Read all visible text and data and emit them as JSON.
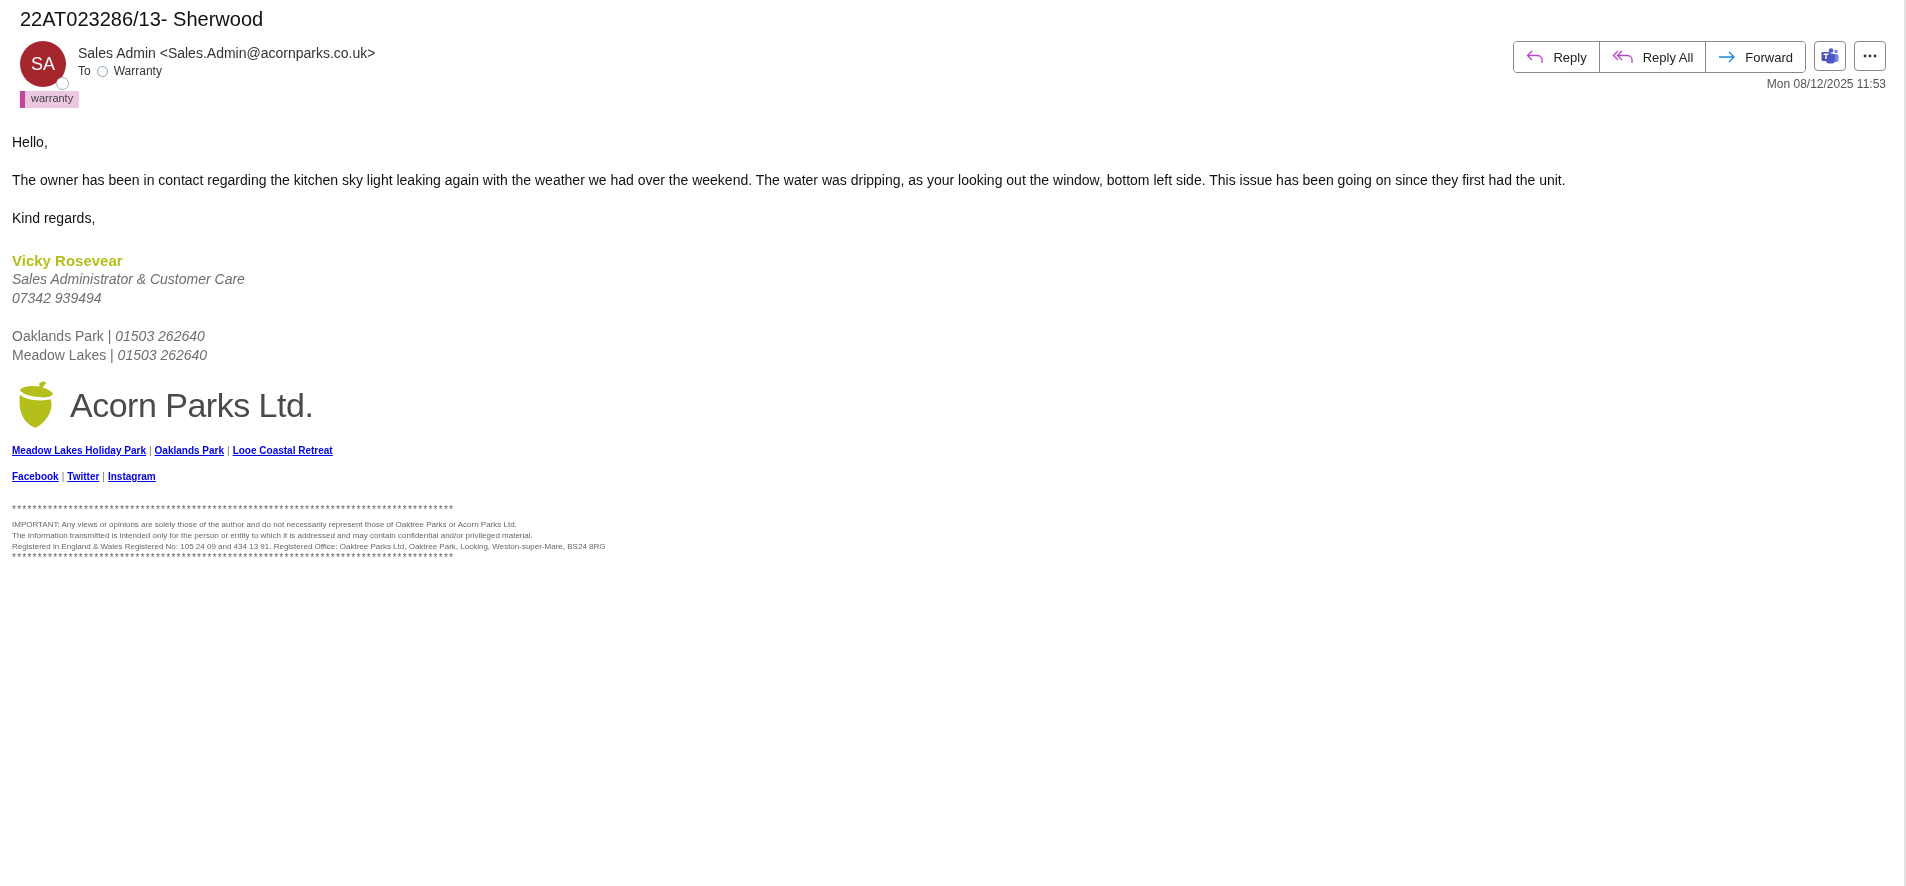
{
  "subject": "22AT023286/13- Sherwood",
  "sender": {
    "initials": "SA",
    "name": "Sales Admin <Sales.Admin@acornparks.co.uk>",
    "to_label": "To",
    "recipient": "Warranty"
  },
  "category": {
    "label": "warranty",
    "color": "#c0479b"
  },
  "actions": [
    {
      "kind": "reply",
      "label": "Reply"
    },
    {
      "kind": "reply_all",
      "label": "Reply All"
    },
    {
      "kind": "forward",
      "label": "Forward"
    }
  ],
  "tools": [
    {
      "kind": "teams"
    },
    {
      "kind": "more"
    }
  ],
  "date": "Mon 08/12/2025 11:53",
  "body": {
    "greeting": "Hello,",
    "paragraph": "The owner has been in contact regarding the kitchen sky light leaking again with the weather we had over the weekend. The water was dripping, as your looking out the window, bottom left side. This issue has been going on since they first had the unit.",
    "closing": "Kind regards,"
  },
  "signature": {
    "name": "Vicky Rosevear",
    "title": "Sales Administrator & Customer Care",
    "phone": "07342 939494",
    "sites": [
      {
        "name": "Oaklands Park |",
        "phone": "01503 262640"
      },
      {
        "name": "Meadow Lakes |",
        "phone": "01503 262640"
      }
    ],
    "logo_text": "Acorn Parks Ltd.",
    "link_rows": [
      [
        {
          "kind": "link",
          "text": "Meadow Lakes Holiday Park"
        },
        {
          "kind": "separator",
          "text": "|"
        },
        {
          "kind": "link",
          "text": "Oaklands Park"
        },
        {
          "kind": "separator",
          "text": "|"
        },
        {
          "kind": "link",
          "text": "Looe Coastal Retreat"
        }
      ],
      [
        {
          "kind": "link",
          "text": "Facebook"
        },
        {
          "kind": "separator",
          "text": "|"
        },
        {
          "kind": "link",
          "text": "Twitter"
        },
        {
          "kind": "separator",
          "text": "|"
        },
        {
          "kind": "link",
          "text": "Instagram"
        }
      ]
    ]
  },
  "disclaimer": {
    "rule_top": "**************************************************************************************",
    "lines": [
      "IMPORTANT: Any views or opinions are solely those of the author and do not necessarily represent those of Oaktree Parks or Acorn Parks Ltd.",
      "The information transmitted is intended only for the person or entity to which it is addressed and may contain confidential and/or privileged material.",
      "Registered in England & Wales Registered No: 105 24 09 and 434 13 91. Registered Office: Oaktree Parks Ltd, Oaktree Park, Locking, Weston-super-Mare, BS24 8RG"
    ],
    "rule_bottom": "**************************************************************************************"
  }
}
